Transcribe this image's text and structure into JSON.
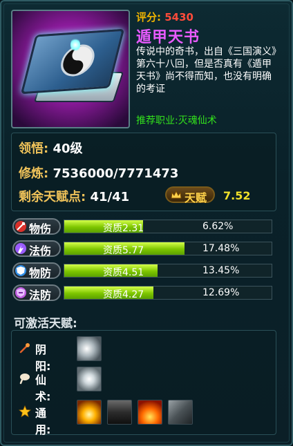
{
  "item": {
    "score_label": "评分:",
    "score_value": "5430",
    "name": "遁甲天书",
    "description": "传说中的奇书，出自《三国演义》第六十八回，但是否真有《遁甲天书》尚不得而知，也没有明确的考证",
    "recommend": "推荐职业:灭魂仙术",
    "icon": "taiji-book-icon"
  },
  "stats": {
    "comprehension_label": "领悟:",
    "comprehension_value": "40级",
    "cultivation_label": "修炼:",
    "cultivation_value": "7536000/7771473",
    "talent_points_label": "剩余天赋点:",
    "talent_points_value": "41/41",
    "talent_button_label": "天赋",
    "talent_value": "7.52"
  },
  "attributes": [
    {
      "label": "物伤",
      "quality": "资质2.31",
      "fill_pct": 0.38,
      "percent": "6.62%",
      "icon": "physical-attack-icon",
      "color": "#d9302a"
    },
    {
      "label": "法伤",
      "quality": "资质5.77",
      "fill_pct": 0.58,
      "percent": "17.48%",
      "icon": "magic-attack-icon",
      "color": "#9b5cff"
    },
    {
      "label": "物防",
      "quality": "资质4.51",
      "fill_pct": 0.45,
      "percent": "13.45%",
      "icon": "physical-defense-icon",
      "color": "#2e8de6"
    },
    {
      "label": "法防",
      "quality": "资质4.27",
      "fill_pct": 0.43,
      "percent": "12.69%",
      "icon": "magic-defense-icon",
      "color": "#c05ce0"
    }
  ],
  "talents": {
    "section_title": "可激活天赋:",
    "rows": [
      {
        "label": "阴阳:",
        "icon": "yinyang-wand-icon",
        "skills": [
          "wind-slash-skill"
        ]
      },
      {
        "label": "仙术:",
        "icon": "immortal-hand-icon",
        "skills": [
          "light-burst-skill"
        ]
      },
      {
        "label": "通用:",
        "icon": "star-icon",
        "skills": [
          "golden-pillar-skill",
          "shadow-figure-skill",
          "fire-crown-skill",
          "dragon-claw-skill"
        ]
      }
    ]
  }
}
